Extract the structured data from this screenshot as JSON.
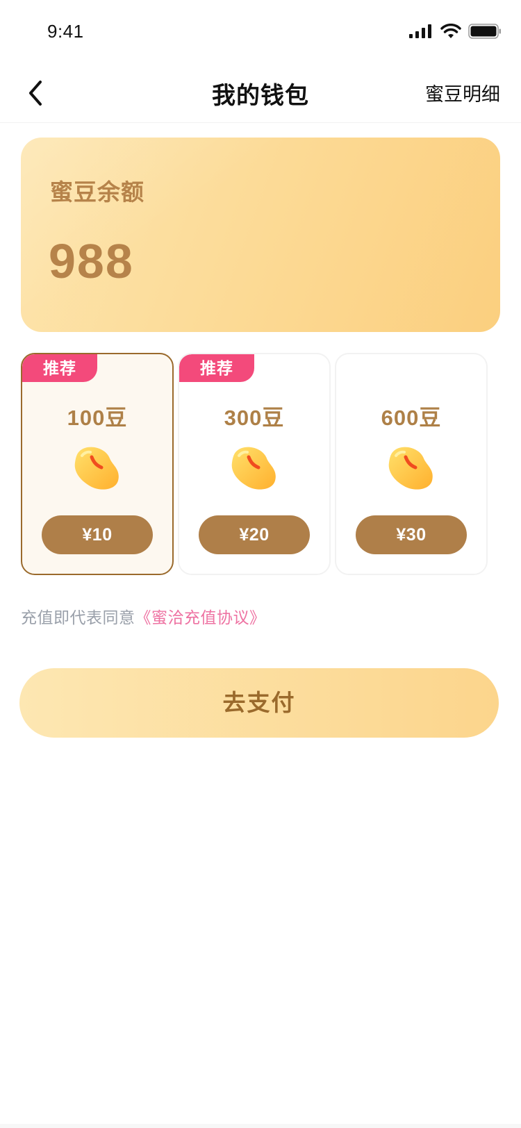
{
  "status_bar": {
    "time": "9:41",
    "icons": [
      "signal-icon",
      "wifi-icon",
      "battery-icon"
    ]
  },
  "nav": {
    "back_icon": "chevron-left-icon",
    "title": "我的钱包",
    "details_label": "蜜豆明细"
  },
  "balance": {
    "label": "蜜豆余额",
    "value": "988"
  },
  "packages": [
    {
      "badge": "推荐",
      "amount": "100豆",
      "price": "¥10",
      "selected": true
    },
    {
      "badge": "推荐",
      "amount": "300豆",
      "price": "¥20",
      "selected": false
    },
    {
      "badge": "",
      "amount": "600豆",
      "price": "¥30",
      "selected": false
    }
  ],
  "agreement": {
    "prefix": "充值即代表同意",
    "link": "《蜜洽充值协议》"
  },
  "pay_button": {
    "label": "去支付"
  },
  "colors": {
    "accent_brown": "#af7f49",
    "badge_pink": "#f34a7b",
    "link_pink": "#ee72a2",
    "card_gold": "#fcd993"
  }
}
